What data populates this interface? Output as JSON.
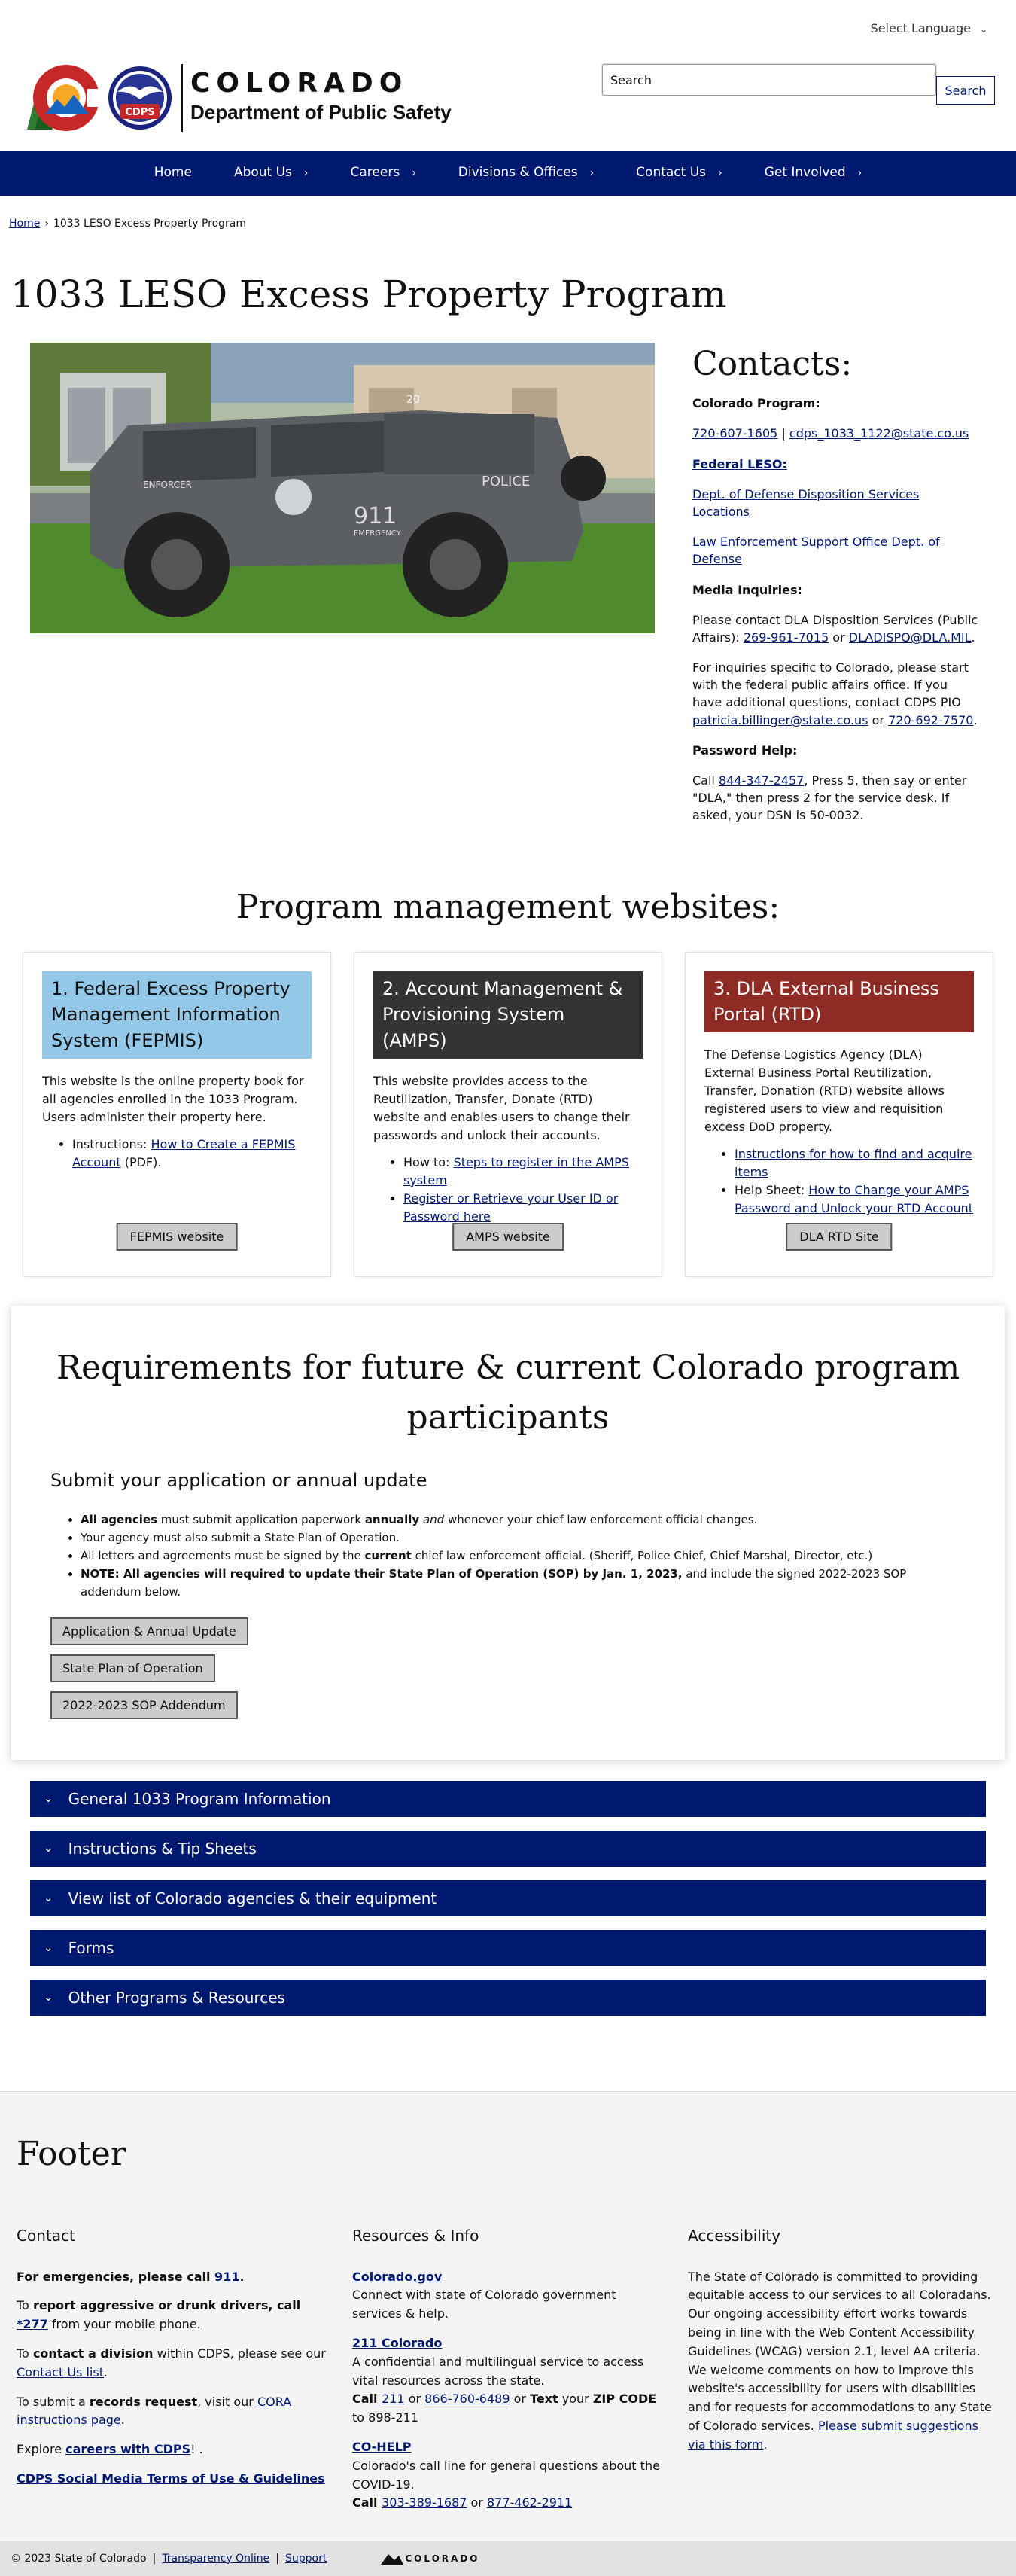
{
  "header": {
    "language": "Select Language",
    "brand_line1": "COLORADO",
    "brand_line2": "Department of Public Safety",
    "cdps_badge": "CDPS",
    "search_placeholder": "Search",
    "search_value": "Search",
    "search_button": "Search"
  },
  "nav": [
    {
      "label": "Home",
      "chev": false
    },
    {
      "label": "About Us",
      "chev": true
    },
    {
      "label": "Careers",
      "chev": true
    },
    {
      "label": "Divisions & Offices",
      "chev": true
    },
    {
      "label": "Contact Us",
      "chev": true
    },
    {
      "label": "Get Involved",
      "chev": true
    }
  ],
  "breadcrumb": {
    "home": "Home",
    "current": "1033 LESO Excess Property Program"
  },
  "page_title": "1033 LESO Excess Property Program",
  "hero_vehicle": {
    "number": "911",
    "subtext": "EMERGENCY",
    "police": "POLICE",
    "cab": "ENFORCER",
    "id": "20"
  },
  "contacts": {
    "title": "Contacts:",
    "co_program": "Colorado Program:",
    "phone1": "720-607-1605",
    "pipe": "|",
    "email1": "cdps_1033_1122@state.co.us",
    "federal": "Federal LESO:",
    "dod_link": "Dept. of Defense Disposition Services Locations",
    "leso_link": "Law Enforcement Support Office Dept. of Defense",
    "media": "Media Inquiries:",
    "media_text": "Please contact DLA Disposition Services (Public Affairs):",
    "media_phone": "269-961-7015",
    "or": "or",
    "media_email": "DLADISPO@DLA.MIL",
    "co_inquiry": "For inquiries specific to Colorado, please start with the federal public affairs office. If you have additional questions, contact CDPS PIO",
    "pio_email": "patricia.billinger@state.co.us",
    "pio_phone": "720-692-7570",
    "password": "Password Help:",
    "call": "Call",
    "pw_phone": "844-347-2457",
    "pw_text": ", Press 5, then say or enter \"DLA,\" then press 2 for the service desk. If asked, your DSN is  50-0032."
  },
  "pm_title": "Program management websites:",
  "cards": [
    {
      "head": "1. Federal Excess Property Management Information System (FEPMIS)",
      "head_bg": "#93c8e8",
      "head_color": "#111",
      "text": "This website is the online property book for all agencies enrolled in the 1033 Program. Users administer their property here.",
      "items": [
        {
          "prefix": "Instructions: ",
          "link": "How to Create a FEPMIS Account",
          "suffix": " (PDF)."
        }
      ],
      "button": "FEPMIS website"
    },
    {
      "head": "2. Account Management & Provisioning System (AMPS)",
      "head_bg": "#333333",
      "head_color": "#fff",
      "text": "This website provides access to the Reutilization, Transfer, Donate (RTD) website and enables users to change their passwords and unlock their accounts.",
      "items": [
        {
          "prefix": "How to: ",
          "link": "Steps to register in the AMPS system",
          "suffix": ""
        },
        {
          "prefix": "",
          "link": "Register or Retrieve your User ID or Password here",
          "suffix": ""
        }
      ],
      "button": "AMPS website"
    },
    {
      "head": "3. DLA External Business Portal (RTD)",
      "head_bg": "#8e2b24",
      "head_color": "#fff",
      "text": "The Defense Logistics Agency (DLA) External Business Portal Reutilization, Transfer, Donation (RTD) website allows registered users to view and requisition excess DoD property.",
      "items": [
        {
          "prefix": "",
          "link": "Instructions for how to find and acquire items",
          "suffix": ""
        },
        {
          "prefix": "Help Sheet: ",
          "link": "How to Change your AMPS Password and Unlock your RTD Account",
          "suffix": ""
        }
      ],
      "button": "DLA RTD Site"
    }
  ],
  "requirements": {
    "title": "Requirements for future & current Colorado program participants",
    "subtitle": "Submit your application or annual update",
    "b1_bold": "All agencies",
    "b1_a": " must submit application paperwork ",
    "b1_bold2": "annually",
    "b1_sp": " ",
    "b1_ital": "and",
    "b1_b": " whenever your chief law enforcement official changes.",
    "b2": "Your agency must also submit a State Plan of Operation.",
    "b3_a": "All letters and agreements must be signed by the ",
    "b3_bold": "current",
    "b3_b": " chief law enforcement official. (Sheriff, Police Chief, Chief Marshal, Director, etc.)",
    "b4_bold": "NOTE: All agencies will required to update their State Plan of Operation (SOP) by Jan. 1, 2023,",
    "b4_b": " and include the signed 2022-2023 SOP addendum below.",
    "buttons": [
      "Application & Annual Update",
      "State Plan of Operation",
      "2022-2023 SOP Addendum"
    ]
  },
  "accordion": [
    "General 1033 Program Information",
    "Instructions & Tip Sheets",
    "View list of Colorado agencies & their equipment",
    "Forms",
    "Other Programs & Resources"
  ],
  "footer": {
    "title": "Footer",
    "contact_h": "Contact",
    "c1a": "For emergencies, please call ",
    "c1link": "911",
    "c1b": ".",
    "c2a": "To ",
    "c2bold": "report aggressive or drunk drivers, call ",
    "c2link": "*277",
    "c2b": " from your mobile phone.",
    "c3a": "To ",
    "c3bold": "contact a division",
    "c3b": " within CDPS, please see our ",
    "c3link": "Contact Us list",
    "c3c": ".",
    "c4a": "To submit a ",
    "c4bold": "records request",
    "c4b": ", visit our ",
    "c4link": "CORA instructions page",
    "c4c": ".",
    "c5a": "Explore ",
    "c5link": "careers with CDPS",
    "c5b": "! .",
    "c6link": "CDPS Social Media Terms of Use & Guidelines",
    "res_h": "Resources & Info",
    "r1link": "Colorado.gov",
    "r1text": "Connect with state of Colorado government services & help.",
    "r2link": "211 Colorado",
    "r2text": "A confidential and multilingual service to access vital resources across the state.",
    "r2call": "Call ",
    "r2a": "211",
    "r2or": " or ",
    "r2b": "866-760-6489",
    "r2or2": " or ",
    "r2text2": "Text",
    "r2your": " your ",
    "r2zip": "ZIP CODE",
    "r2to": " to 898-211",
    "r3link": "CO-HELP",
    "r3text": "Colorado's call line for general questions about the COVID-19.",
    "r3call": "Call ",
    "r3a": "303-389-1687",
    "r3or": " or ",
    "r3b": "877-462-2911",
    "acc_h": "Accessibility",
    "acc_text": "The State of Colorado is committed to providing equitable access to our services to all Coloradans. Our ongoing accessibility effort works towards being in line with the Web Content Accessibility Guidelines (WCAG) version 2.1, level AA criteria. We welcome comments on how to improve this website's accessibility for users with disabilities and for requests for accommodations to any State of Colorado services. ",
    "acc_link": "Please submit suggestions via this form",
    "acc_end": "."
  },
  "bottom": {
    "copyright": "© 2023 State of Colorado",
    "sep": "|",
    "transparency": "Transparency Online",
    "support": "Support",
    "logo": "COLORADO"
  },
  "colors": {
    "navy": "#001970",
    "fepmis": "#93c8e8",
    "amps": "#333333",
    "rtd": "#8e2b24"
  }
}
